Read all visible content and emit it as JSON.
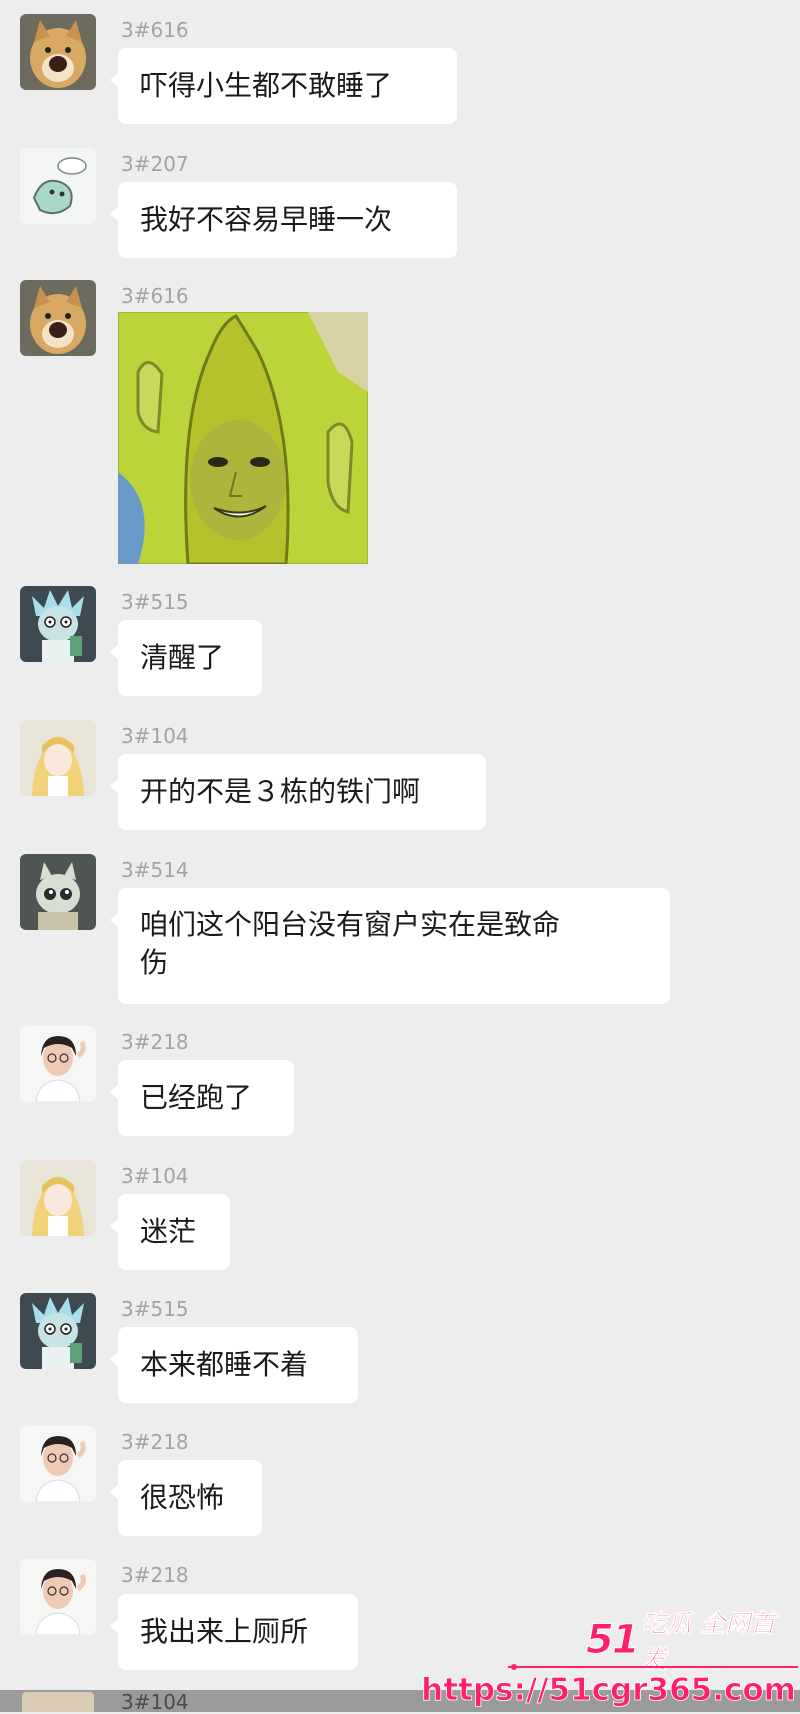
{
  "messages": [
    {
      "sender": "3#616",
      "text": "吓得小生都不敢睡了",
      "avatar": "shiba-dog-avatar"
    },
    {
      "sender": "3#207",
      "text": "我好不容易早睡一次",
      "avatar": "sketch-character-avatar"
    },
    {
      "sender": "3#616",
      "sticker": "banana-face-sticker",
      "avatar": "shiba-dog-avatar"
    },
    {
      "sender": "3#515",
      "text": "清醒了",
      "avatar": "rick-cartoon-avatar"
    },
    {
      "sender": "3#104",
      "text": "开的不是３栋的铁门啊",
      "avatar": "anime-girl-avatar"
    },
    {
      "sender": "3#514",
      "text_line1": "咱们这个阳台没有窗户实在是致命",
      "text_line2": "伤",
      "avatar": "cartoon-cat-avatar"
    },
    {
      "sender": "3#218",
      "text": "已经跑了",
      "avatar": "person-photo-avatar"
    },
    {
      "sender": "3#104",
      "text": "迷茫",
      "avatar": "anime-girl-avatar"
    },
    {
      "sender": "3#515",
      "text": "本来都睡不着",
      "avatar": "rick-cartoon-avatar"
    },
    {
      "sender": "3#218",
      "text": "很恐怖",
      "avatar": "person-photo-avatar"
    },
    {
      "sender": "3#218",
      "text": "我出来上厕所",
      "avatar": "person-photo-avatar"
    },
    {
      "sender": "3#104"
    }
  ],
  "watermark": {
    "brand_num": "51",
    "brand_text": "吃瓜 全网首发",
    "url": "https://51cgr365.com",
    "color": "#ff1f6a"
  },
  "colors": {
    "background": "#ededed",
    "bubble": "#ffffff",
    "sender": "#a3a3a3",
    "text": "#1b1b1b"
  }
}
